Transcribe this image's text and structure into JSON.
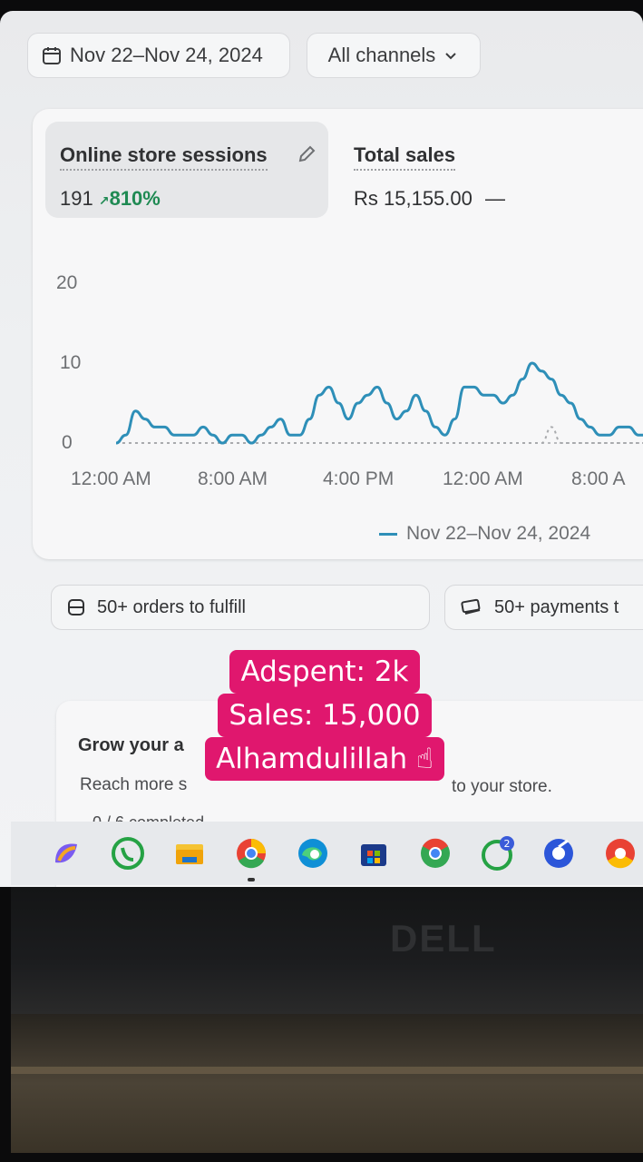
{
  "filters": {
    "date_range": "Nov 22–Nov 24, 2024",
    "channel": "All channels"
  },
  "metrics": [
    {
      "title": "Online store sessions",
      "value": "191",
      "trend": "810%"
    },
    {
      "title": "Total sales",
      "value": "Rs 15,155.00",
      "trend": "—"
    }
  ],
  "chart_data": {
    "type": "line",
    "ylim": [
      0,
      20
    ],
    "y_ticks": [
      "20",
      "10",
      "0"
    ],
    "x_ticks": [
      "12:00 AM",
      "8:00 AM",
      "4:00 PM",
      "12:00 AM",
      "8:00 A"
    ],
    "series": [
      {
        "name": "Nov 22–Nov 24, 2024",
        "color": "#2e8fb8",
        "values": [
          0,
          1,
          4,
          3,
          2,
          2,
          1,
          1,
          1,
          2,
          1,
          0,
          1,
          1,
          0,
          1,
          2,
          3,
          1,
          1,
          3,
          6,
          7,
          5,
          3,
          5,
          6,
          7,
          5,
          3,
          4,
          6,
          4,
          2,
          1,
          3,
          7,
          7,
          6,
          6,
          5,
          6,
          8,
          10,
          9,
          8,
          6,
          5,
          3,
          2,
          1,
          1,
          2,
          2,
          1,
          1,
          0,
          0
        ]
      }
    ],
    "comparison_series": {
      "values": [
        0,
        0,
        0,
        0,
        0,
        0,
        0,
        0,
        0,
        0,
        0,
        0,
        0,
        0,
        0,
        0,
        0,
        0,
        0,
        0,
        0,
        0,
        0,
        0,
        0,
        0,
        0,
        0,
        0,
        0,
        0,
        0,
        0,
        0,
        0,
        0,
        0,
        0,
        0,
        0,
        0,
        0,
        0,
        0,
        0,
        2,
        0,
        0,
        0,
        0,
        0,
        0,
        0,
        0,
        0,
        0,
        0,
        0
      ]
    }
  },
  "tasks": [
    {
      "label": "50+ orders to fulfill"
    },
    {
      "label": "50+ payments t"
    }
  ],
  "grow_card": {
    "title": "Grow your a",
    "description": "Reach more s",
    "description_tail": "to your store.",
    "progress": "0 / 6 completed"
  },
  "overlay": {
    "lines": [
      "Adspent: 2k",
      "Sales: 15,000",
      "Alhamdulillah ☝"
    ]
  },
  "laptop": {
    "brand": "DELL"
  }
}
